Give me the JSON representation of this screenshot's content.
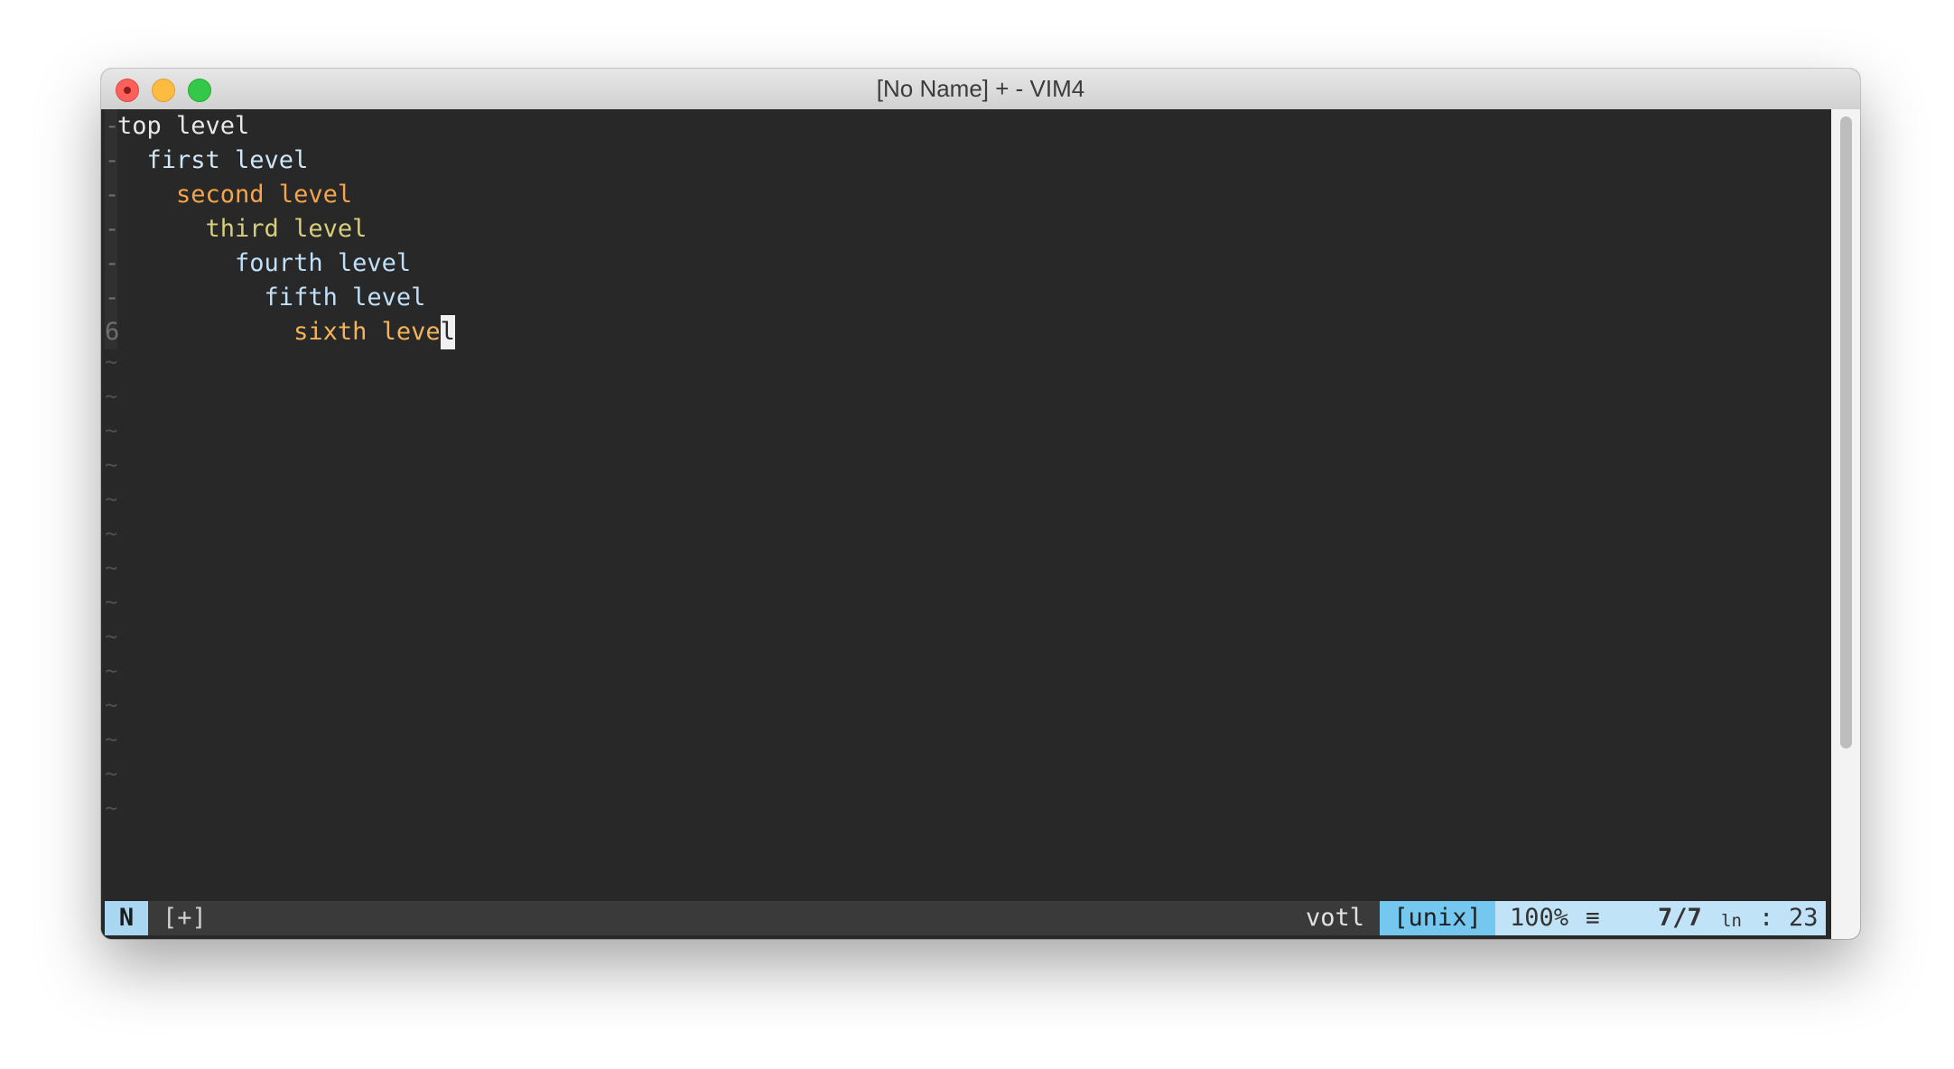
{
  "window": {
    "title": "[No Name] + - VIM4"
  },
  "buffer": {
    "lines": [
      {
        "gutter": "-",
        "text": "top level",
        "color": "#e8e8e8"
      },
      {
        "gutter": "-",
        "text": "  first level",
        "color": "#cfe6f7"
      },
      {
        "gutter": "-",
        "text": "    second level",
        "color": "#f4a44b"
      },
      {
        "gutter": "-",
        "text": "      third level",
        "color": "#d8cf7c"
      },
      {
        "gutter": "-",
        "text": "        fourth level",
        "color": "#bfe0f8"
      },
      {
        "gutter": "-",
        "text": "          fifth level",
        "color": "#bfe0f8"
      },
      {
        "gutter": "6",
        "text_before_cursor": "            sixth leve",
        "cursor_char": "l",
        "color": "#f4b45a"
      }
    ],
    "tilde_marker": "~"
  },
  "statusline": {
    "mode": "N",
    "modified": "[+]",
    "filetype": "votl",
    "fileformat": "[unix]",
    "percent": "100%",
    "menu_icon": "≡",
    "position": "7/7",
    "ln_label": "ln",
    "colon": ":",
    "column": "23"
  },
  "colors": {
    "mode_bg": "#a9d7f1",
    "fileformat_bg": "#74c7ef",
    "rightinfo_bg": "#c0e3f8",
    "editor_bg": "#282828"
  }
}
